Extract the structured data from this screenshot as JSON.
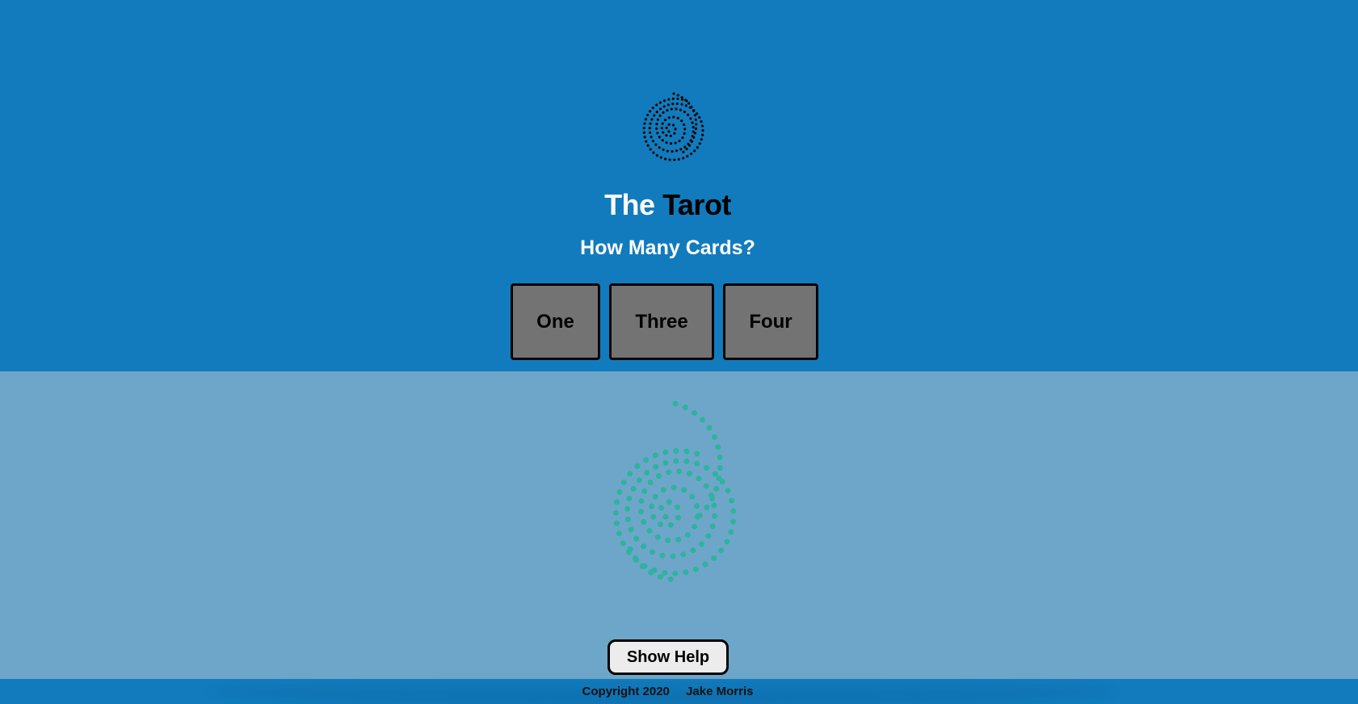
{
  "header": {
    "logo_icon": "fingerprint-icon",
    "title_word1": "The",
    "title_word2": "Tarot",
    "subtitle": "How Many Cards?"
  },
  "card_buttons": [
    {
      "label": "One"
    },
    {
      "label": "Three"
    },
    {
      "label": "Four"
    }
  ],
  "main": {
    "illustration_icon": "fingerprint-icon",
    "help_button_label": "Show Help"
  },
  "footer": {
    "copyright": "Copyright 2020",
    "author": "Jake Morris"
  },
  "colors": {
    "top_background": "#127bbd",
    "bottom_background": "#6ea6c9",
    "fingerprint_top": "#0a0a0a",
    "fingerprint_bottom": "#2eb39e",
    "card_button_fill": "#737373"
  }
}
